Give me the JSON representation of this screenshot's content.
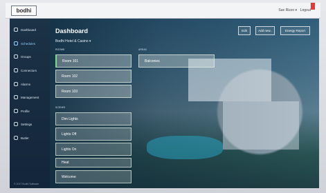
{
  "topbar": {
    "logo": "bodhi",
    "user_menu": "Sue Rizzo ▾",
    "logout": "Logout"
  },
  "sidebar": {
    "items": [
      {
        "label": "Dashboard",
        "icon": "dashboard-icon",
        "active": false
      },
      {
        "label": "Schedules",
        "icon": "calendar-icon",
        "active": true
      },
      {
        "label": "Groups",
        "icon": "groups-icon",
        "active": false
      },
      {
        "label": "Connectors",
        "icon": "plug-icon",
        "active": false
      },
      {
        "label": "Alarms",
        "icon": "bell-icon",
        "active": false
      },
      {
        "label": "Management",
        "icon": "management-icon",
        "active": false
      },
      {
        "label": "Profile",
        "icon": "user-icon",
        "active": false
      },
      {
        "label": "Settings",
        "icon": "gear-icon",
        "active": false
      },
      {
        "label": "Butler",
        "icon": "butler-icon",
        "active": false
      }
    ],
    "footer": "© 2017 Bodhi Software"
  },
  "main": {
    "title": "Dashboard",
    "property": "Bodhi Hotel & Casino ▾",
    "buttons": {
      "edit": "Edit",
      "add_new": "Add new..",
      "energy_report": "Energy Report"
    },
    "rooms_label": "ROOMS",
    "areas_label": "AREAS",
    "scenes_label": "SCENES",
    "rooms": [
      "Room 101",
      "Room 102",
      "Room 103"
    ],
    "areas": [
      "Balconies"
    ],
    "scenes": [
      "Dim Lights",
      "Lights Off",
      "Lights On",
      "Welcome"
    ],
    "extra": "Heat"
  }
}
